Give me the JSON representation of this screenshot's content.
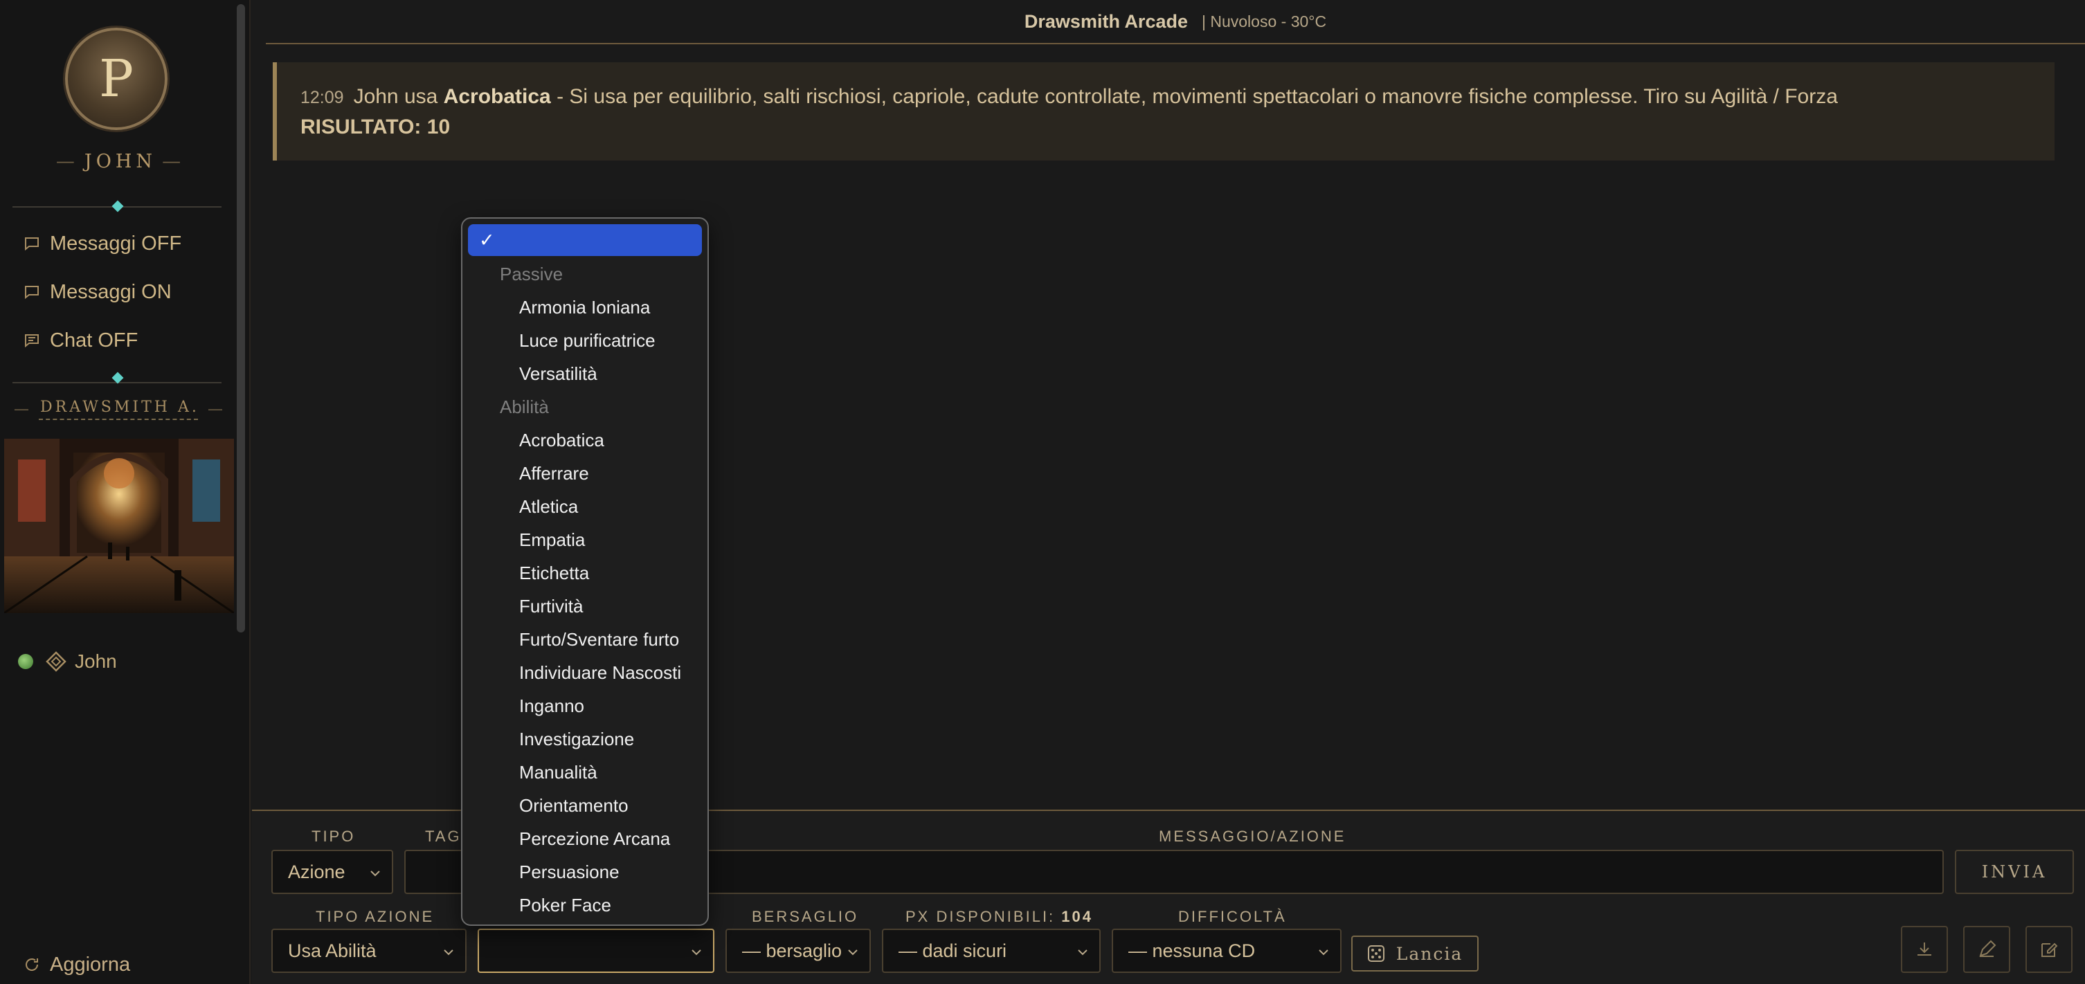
{
  "sidebar": {
    "emblem_letter": "P",
    "character_name": "JOHN",
    "links": [
      {
        "label": "Messaggi OFF",
        "icon": "message-icon"
      },
      {
        "label": "Messaggi ON",
        "icon": "message-icon"
      },
      {
        "label": "Chat OFF",
        "icon": "chat-icon"
      }
    ],
    "location_name": "DRAWSMITH A...",
    "users": [
      {
        "name": "John",
        "status": "online"
      }
    ],
    "refresh_label": "Aggiorna"
  },
  "header": {
    "title": "Drawsmith Arcade",
    "weather": "| Nuvoloso - 30°C"
  },
  "message": {
    "time": "12:09",
    "actor_text": "John usa",
    "skill": "Acrobatica",
    "description": "- Si usa per equilibrio, salti rischiosi, capriole, cadute controllate, movimenti spettacolari o manovre fisiche complesse. Tiro su Agilità / Forza",
    "result": "RISULTATO: 10"
  },
  "form": {
    "tipo_label": "TIPO",
    "tipo_value": "Azione",
    "tag_label": "TAG/",
    "message_label": "MESSAGGIO/AZIONE",
    "message_value": "",
    "send_label": "INVIA",
    "action_type_label": "TIPO AZIONE",
    "action_type_value": "Usa Abilità",
    "skill_value": "",
    "target_label": "BERSAGLIO",
    "target_value": "— bersaglio",
    "px_label": "PX DISPONIBILI:",
    "px_value": "104",
    "px_select_value": "— dadi sicuri",
    "difficulty_label": "DIFFICOLTÀ",
    "difficulty_value": "— nessuna CD",
    "roll_label": "Lancia"
  },
  "dropdown": {
    "selected_check": "✓",
    "groups": [
      {
        "label": "Passive",
        "options": [
          "Armonia Ioniana",
          "Luce purificatrice",
          "Versatilità"
        ]
      },
      {
        "label": "Abilità",
        "options": [
          "Acrobatica",
          "Afferrare",
          "Atletica",
          "Empatia",
          "Etichetta",
          "Furtività",
          "Furto/Sventare furto",
          "Individuare Nascosti",
          "Inganno",
          "Investigazione",
          "Manualità",
          "Orientamento",
          "Percezione Arcana",
          "Persuasione",
          "Poker Face"
        ]
      }
    ]
  },
  "colors": {
    "accent_gold": "#b89a6a",
    "gem_teal": "#5fd1c8",
    "selection_blue": "#2c55d0",
    "background": "#1a1a1a"
  }
}
